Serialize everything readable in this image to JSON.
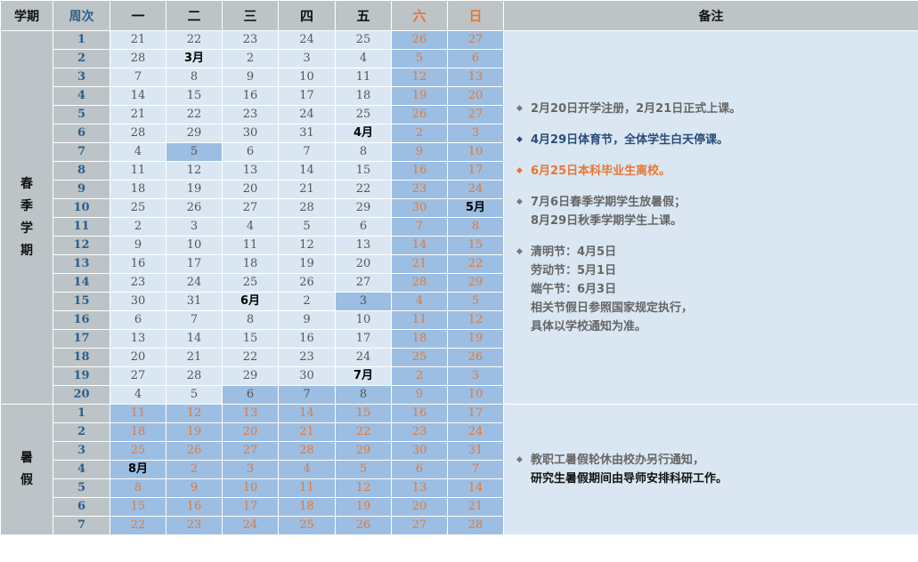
{
  "header": {
    "term": "学期",
    "week": "周次",
    "days": [
      "一",
      "二",
      "三",
      "四",
      "五",
      "六",
      "日"
    ],
    "remarks": "备注"
  },
  "colors": {
    "header_bg": "#bcc4c8",
    "cell_bg": "#dae7f3",
    "highlight_bg": "#9cbee3",
    "weekend_text": "#e8772e",
    "week_text": "#2e5f8a",
    "note_blue": "#2a4d7a"
  },
  "spring": {
    "label": "春季学期",
    "weeks": [
      {
        "week": "1",
        "days": [
          "21",
          "22",
          "23",
          "24",
          "25",
          "26",
          "27"
        ],
        "hl": [
          0,
          0,
          0,
          0,
          0,
          1,
          1
        ]
      },
      {
        "week": "2",
        "days": [
          "28",
          "3月",
          "2",
          "3",
          "4",
          "5",
          "6"
        ],
        "hl": [
          0,
          0,
          0,
          0,
          0,
          1,
          1
        ]
      },
      {
        "week": "3",
        "days": [
          "7",
          "8",
          "9",
          "10",
          "11",
          "12",
          "13"
        ],
        "hl": [
          0,
          0,
          0,
          0,
          0,
          1,
          1
        ]
      },
      {
        "week": "4",
        "days": [
          "14",
          "15",
          "16",
          "17",
          "18",
          "19",
          "20"
        ],
        "hl": [
          0,
          0,
          0,
          0,
          0,
          1,
          1
        ]
      },
      {
        "week": "5",
        "days": [
          "21",
          "22",
          "23",
          "24",
          "25",
          "26",
          "27"
        ],
        "hl": [
          0,
          0,
          0,
          0,
          0,
          1,
          1
        ]
      },
      {
        "week": "6",
        "days": [
          "28",
          "29",
          "30",
          "31",
          "4月",
          "2",
          "3"
        ],
        "hl": [
          0,
          0,
          0,
          0,
          0,
          1,
          1
        ]
      },
      {
        "week": "7",
        "days": [
          "4",
          "5",
          "6",
          "7",
          "8",
          "9",
          "10"
        ],
        "hl": [
          0,
          1,
          0,
          0,
          0,
          1,
          1
        ]
      },
      {
        "week": "8",
        "days": [
          "11",
          "12",
          "13",
          "14",
          "15",
          "16",
          "17"
        ],
        "hl": [
          0,
          0,
          0,
          0,
          0,
          1,
          1
        ]
      },
      {
        "week": "9",
        "days": [
          "18",
          "19",
          "20",
          "21",
          "22",
          "23",
          "24"
        ],
        "hl": [
          0,
          0,
          0,
          0,
          0,
          1,
          1
        ]
      },
      {
        "week": "10",
        "days": [
          "25",
          "26",
          "27",
          "28",
          "29",
          "30",
          "5月"
        ],
        "hl": [
          0,
          0,
          0,
          0,
          0,
          1,
          1
        ]
      },
      {
        "week": "11",
        "days": [
          "2",
          "3",
          "4",
          "5",
          "6",
          "7",
          "8"
        ],
        "hl": [
          0,
          0,
          0,
          0,
          0,
          1,
          1
        ]
      },
      {
        "week": "12",
        "days": [
          "9",
          "10",
          "11",
          "12",
          "13",
          "14",
          "15"
        ],
        "hl": [
          0,
          0,
          0,
          0,
          0,
          1,
          1
        ]
      },
      {
        "week": "13",
        "days": [
          "16",
          "17",
          "18",
          "19",
          "20",
          "21",
          "22"
        ],
        "hl": [
          0,
          0,
          0,
          0,
          0,
          1,
          1
        ]
      },
      {
        "week": "14",
        "days": [
          "23",
          "24",
          "25",
          "26",
          "27",
          "28",
          "29"
        ],
        "hl": [
          0,
          0,
          0,
          0,
          0,
          1,
          1
        ]
      },
      {
        "week": "15",
        "days": [
          "30",
          "31",
          "6月",
          "2",
          "3",
          "4",
          "5"
        ],
        "hl": [
          0,
          0,
          0,
          0,
          1,
          1,
          1
        ]
      },
      {
        "week": "16",
        "days": [
          "6",
          "7",
          "8",
          "9",
          "10",
          "11",
          "12"
        ],
        "hl": [
          0,
          0,
          0,
          0,
          0,
          1,
          1
        ]
      },
      {
        "week": "17",
        "days": [
          "13",
          "14",
          "15",
          "16",
          "17",
          "18",
          "19"
        ],
        "hl": [
          0,
          0,
          0,
          0,
          0,
          1,
          1
        ]
      },
      {
        "week": "18",
        "days": [
          "20",
          "21",
          "22",
          "23",
          "24",
          "25",
          "26"
        ],
        "hl": [
          0,
          0,
          0,
          0,
          0,
          1,
          1
        ]
      },
      {
        "week": "19",
        "days": [
          "27",
          "28",
          "29",
          "30",
          "7月",
          "2",
          "3"
        ],
        "hl": [
          0,
          0,
          0,
          0,
          0,
          1,
          1
        ]
      },
      {
        "week": "20",
        "days": [
          "4",
          "5",
          "6",
          "7",
          "8",
          "9",
          "10"
        ],
        "hl": [
          0,
          0,
          1,
          1,
          1,
          1,
          1
        ]
      }
    ],
    "notes": [
      {
        "lines": [
          "2月20日开学注册，2月21日正式上课。"
        ],
        "style": "gray"
      },
      {
        "lines": [
          "4月29日体育节，全体学生白天停课。"
        ],
        "style": "blue"
      },
      {
        "lines": [
          "6月25日本科毕业生离校。"
        ],
        "style": "orange"
      },
      {
        "lines": [
          "7月6日春季学期学生放暑假；",
          "8月29日秋季学期学生上课。"
        ],
        "style": "gray"
      },
      {
        "lines": [
          "清明节：4月5日",
          "劳动节：5月1日",
          "端午节：6月3日",
          "相关节假日参照国家规定执行，",
          "具体以学校通知为准。"
        ],
        "style": "gray"
      }
    ]
  },
  "summer": {
    "label": "暑假",
    "weeks": [
      {
        "week": "1",
        "days": [
          "11",
          "12",
          "13",
          "14",
          "15",
          "16",
          "17"
        ]
      },
      {
        "week": "2",
        "days": [
          "18",
          "19",
          "20",
          "21",
          "22",
          "23",
          "24"
        ]
      },
      {
        "week": "3",
        "days": [
          "25",
          "26",
          "27",
          "28",
          "29",
          "30",
          "31"
        ]
      },
      {
        "week": "4",
        "days": [
          "8月",
          "2",
          "3",
          "4",
          "5",
          "6",
          "7"
        ]
      },
      {
        "week": "5",
        "days": [
          "8",
          "9",
          "10",
          "11",
          "12",
          "13",
          "14"
        ]
      },
      {
        "week": "6",
        "days": [
          "15",
          "16",
          "17",
          "18",
          "19",
          "20",
          "21"
        ]
      },
      {
        "week": "7",
        "days": [
          "22",
          "23",
          "24",
          "25",
          "26",
          "27",
          "28"
        ]
      }
    ],
    "notes": [
      {
        "lines": [
          "教职工暑假轮休由校办另行通知，",
          "研究生暑假期间由导师安排科研工作。"
        ],
        "style": "gray-dark2"
      }
    ]
  }
}
